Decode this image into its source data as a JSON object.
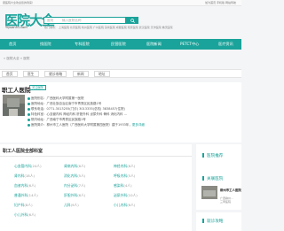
{
  "topbar": {
    "left": "康医院大全欢迎您的到来！",
    "right": "加为首页 手机版 网站导航"
  },
  "logo": {
    "text": "医院大全",
    "sub": "Yiyuan51.com"
  },
  "search": {
    "select": "医院",
    "placeholder": "输入医院名称",
    "button_icon": "search-icon"
  },
  "hot": "热门城市： 上海医院 北京医院 杭州医院 广州医院 深圳医院 成都医院 南京医院 武汉医院 天津医院 重庆医院",
  "nav": [
    "首页",
    "找医院",
    "专科医院",
    "民营医院",
    "医院新闻",
    "PETCT中心",
    "医疗资讯"
  ],
  "breadcrumb": "» 医院大全 » 医院",
  "tabs": [
    "首页",
    "医生",
    "就诊攻略",
    "新闻",
    "地址"
  ],
  "hospital": {
    "name": "职工人医院",
    "attention": "关注医院",
    "rows": [
      {
        "key": "医院别名：",
        "val": "广西医科大学附属第一医院"
      },
      {
        "key": "医院地址：",
        "val": "广西壮族自治区南宁市青秀区民族路1号"
      },
      {
        "key": "联系电话：",
        "val": "0771-3013255(门诊) 3013335(总机) 3838457(住院)"
      },
      {
        "key": "特色科室：",
        "val": "心血管内科 神经内科 肝胆外科 泌尿外科 骨科 消化内科 ..."
      },
      {
        "key": "院内地址：",
        "val": "广西南宁市青秀区民族路1号"
      },
      {
        "key": "医院简介：",
        "val": "柳州市工人医院（广西医科大学附属第四医院）建于1933年，",
        "more": "更多详细"
      }
    ]
  },
  "departments": {
    "title": "职工人医院全部科室",
    "items": [
      {
        "name": "心血管内科",
        "count": "(24人)"
      },
      {
        "name": "肾病内科",
        "count": "(6人)"
      },
      {
        "name": "神经内科",
        "count": "(8人)"
      },
      {
        "name": "肾内科",
        "count": "(18人)"
      },
      {
        "name": "消化内科",
        "count": "(5人)"
      },
      {
        "name": "呼吸内科",
        "count": "(5人)"
      },
      {
        "name": "血液内科",
        "count": "(6人)"
      },
      {
        "name": "内分泌科",
        "count": "(7人)"
      },
      {
        "name": "感染科",
        "count": "(4人)"
      },
      {
        "name": "普通外科",
        "count": "(14人)"
      },
      {
        "name": "肝胆外科",
        "count": "(6人)"
      },
      {
        "name": "泌尿外科",
        "count": "(10人)"
      },
      {
        "name": "妇产科",
        "count": "(8人)"
      },
      {
        "name": "儿科",
        "count": "(9人)"
      },
      {
        "name": "小儿内科",
        "count": "(6人)"
      },
      {
        "name": "小儿外科",
        "count": "(6人)"
      }
    ]
  },
  "side": {
    "recommend": "医院推荐",
    "related": "关联医院",
    "related_item": {
      "name": "柳州市工人医院",
      "addr": "广西柳州...",
      "level": "三甲医院"
    },
    "guide": "就诊攻略"
  },
  "colors": {
    "accent": "#1aa39a"
  }
}
